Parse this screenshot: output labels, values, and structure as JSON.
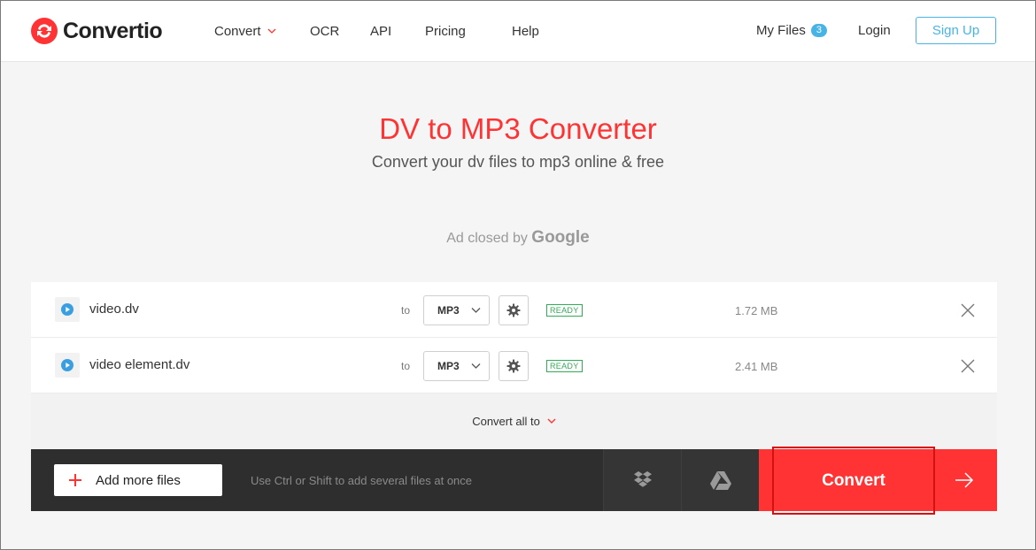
{
  "header": {
    "logo_text": "Convertio",
    "nav": [
      "Convert",
      "OCR",
      "API",
      "Pricing",
      "Help"
    ],
    "my_files_label": "My Files",
    "my_files_count": "3",
    "login_label": "Login",
    "signup_label": "Sign Up"
  },
  "hero": {
    "title": "DV to MP3 Converter",
    "subtitle": "Convert your dv files to mp3 online & free"
  },
  "ad": {
    "text": "Ad closed by",
    "brand": "Google"
  },
  "files": [
    {
      "name": "video.dv",
      "to_label": "to",
      "format": "MP3",
      "status": "READY",
      "size": "1.72 MB"
    },
    {
      "name": "video element.dv",
      "to_label": "to",
      "format": "MP3",
      "status": "READY",
      "size": "2.41 MB"
    }
  ],
  "convert_all_label": "Convert all to",
  "action_bar": {
    "add_files_label": "Add more files",
    "hint": "Use Ctrl or Shift to add several files at once",
    "convert_label": "Convert"
  },
  "colors": {
    "brand_red": "#ff3333",
    "accent_blue": "#48b4e6",
    "ready_green": "#33aa55"
  },
  "icons": {
    "logo": "convertio-logo-icon",
    "file": "play-circle-icon",
    "settings": "gear-icon",
    "remove": "close-icon",
    "dropbox": "dropbox-icon",
    "drive": "google-drive-icon",
    "arrow": "arrow-right-icon"
  }
}
